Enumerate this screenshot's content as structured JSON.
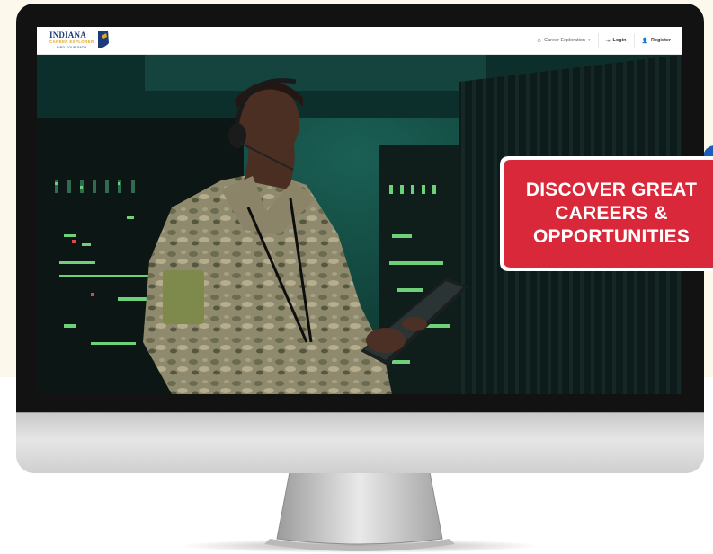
{
  "colors": {
    "background": "#fdf8ec",
    "bezel": "#121212",
    "sticker_red": "#d8283a",
    "logo_navy": "#1c3b78",
    "logo_gold": "#e3a726"
  },
  "logo": {
    "line1": "INDIANA",
    "line2": "CAREER EXPLORER",
    "line3": "FIND YOUR PATH",
    "icon": "indiana-state-icon"
  },
  "nav": {
    "career_exploration": {
      "label": "Career Exploration",
      "icon": "compass-icon",
      "caret": "▾"
    },
    "login": {
      "label": "Login",
      "icon": "login-arrow-icon"
    },
    "register": {
      "label": "Register",
      "icon": "user-plus-icon"
    }
  },
  "hero": {
    "image": "soldier-with-tablet-in-server-room",
    "sticker_lines": [
      "DISCOVER GREAT",
      "CAREERS &",
      "OPPORTUNITIES"
    ]
  }
}
